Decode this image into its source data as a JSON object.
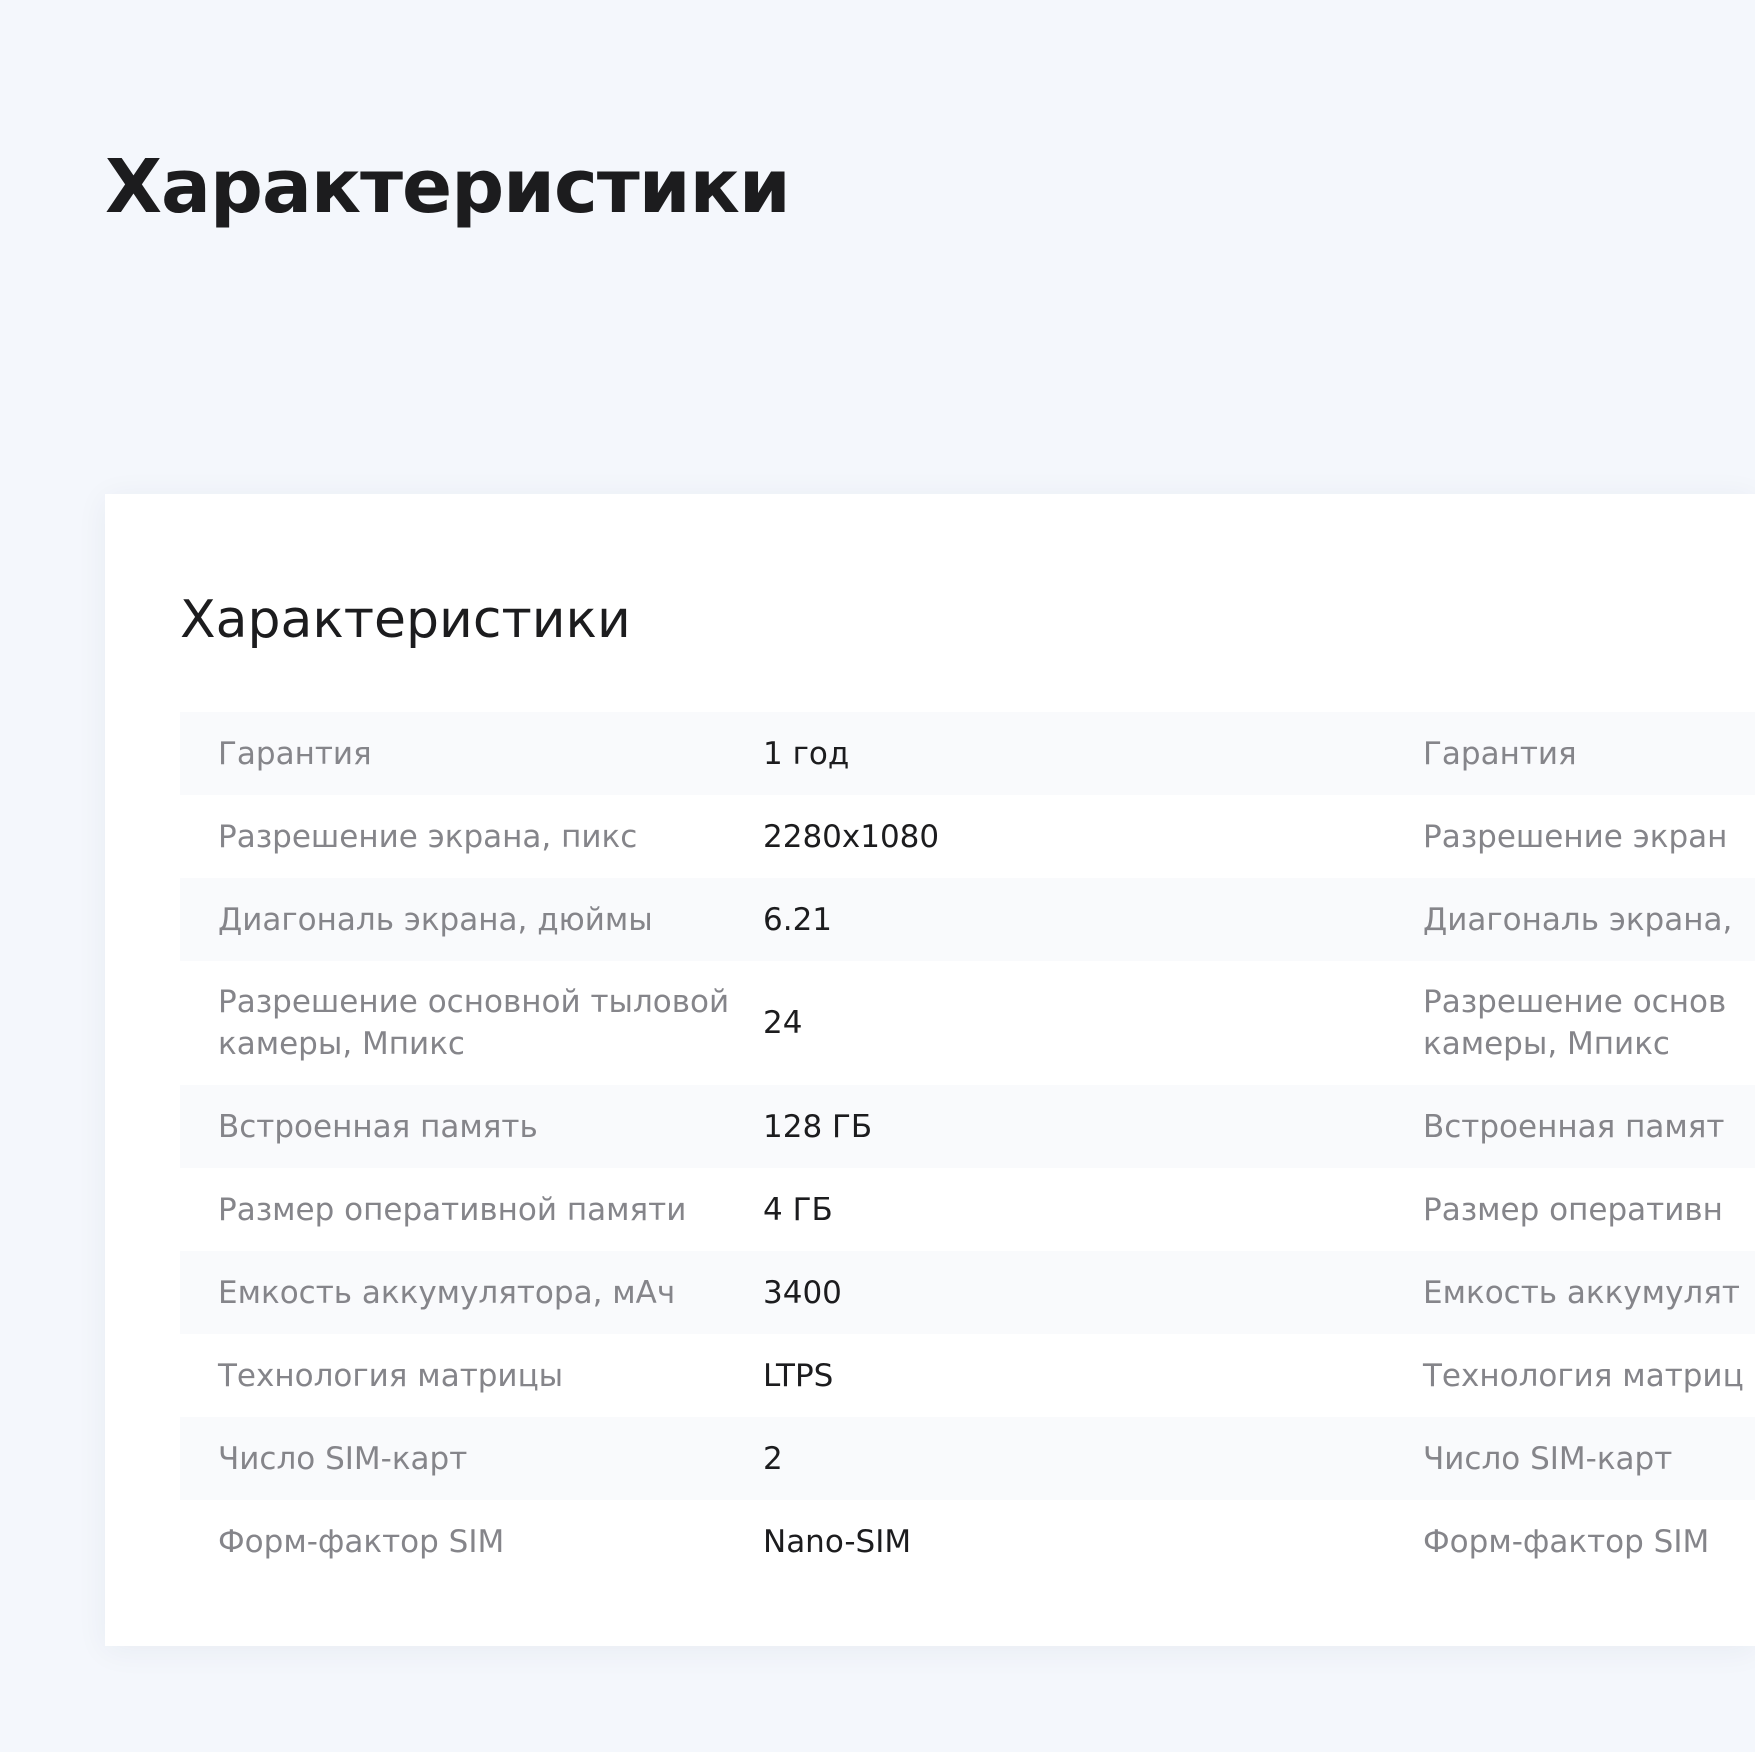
{
  "page": {
    "title": "Характеристики"
  },
  "card": {
    "title": "Характеристики"
  },
  "specs": [
    {
      "label": "Гарантия",
      "value": "1 год",
      "right_label": "Гарантия"
    },
    {
      "label": "Разрешение экрана, пикс",
      "value": "2280x1080",
      "right_label": "Разрешение экран"
    },
    {
      "label": "Диагональ экрана, дюймы",
      "value": "6.21",
      "right_label": "Диагональ экрана,"
    },
    {
      "label": "Разрешение основной тыловой камеры, Мпикс",
      "value": "24",
      "right_label": "Разрешение основ камеры, Мпикс"
    },
    {
      "label": "Встроенная память",
      "value": "128 ГБ",
      "right_label": "Встроенная памят"
    },
    {
      "label": "Размер оперативной памяти",
      "value": "4 ГБ",
      "right_label": "Размер оперативн"
    },
    {
      "label": "Емкость аккумулятора, мАч",
      "value": "3400",
      "right_label": "Емкость аккумулят"
    },
    {
      "label": "Технология матрицы",
      "value": "LTPS",
      "right_label": "Технология матриц"
    },
    {
      "label": "Число SIM-карт",
      "value": "2",
      "right_label": "Число SIM-карт"
    },
    {
      "label": "Форм-фактор SIM",
      "value": "Nano-SIM",
      "right_label": "Форм-фактор SIM"
    }
  ]
}
